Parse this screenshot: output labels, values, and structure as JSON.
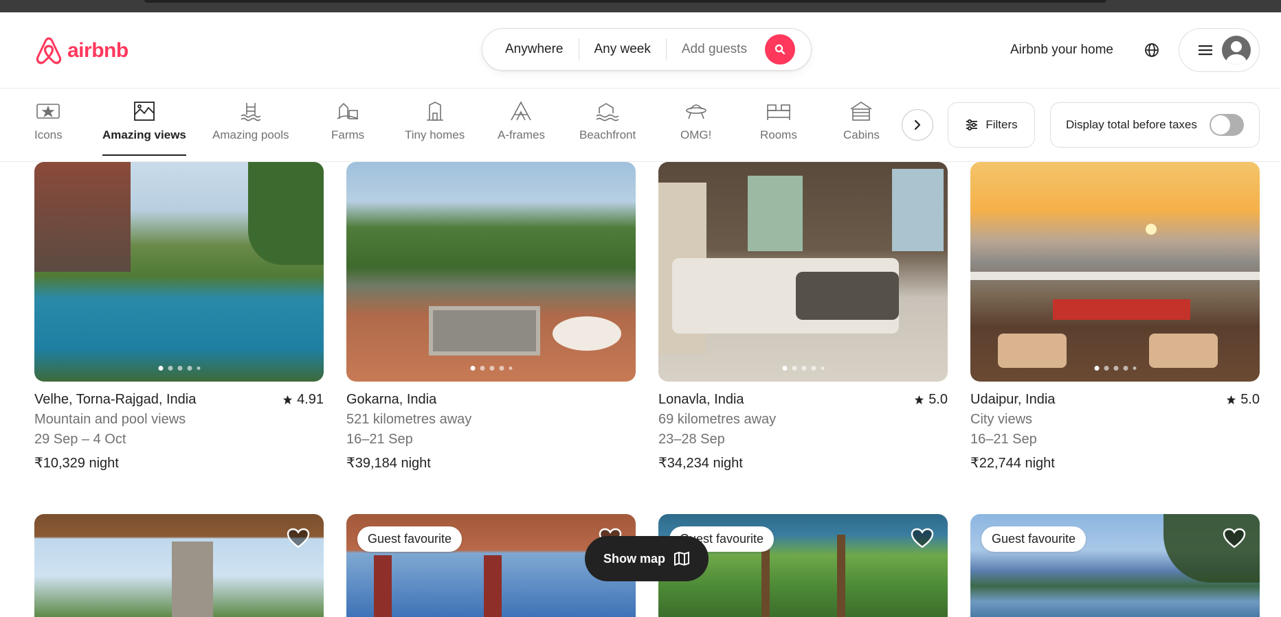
{
  "brand": {
    "name": "airbnb",
    "color": "#ff385c"
  },
  "search": {
    "where": "Anywhere",
    "when": "Any week",
    "who": "Add guests"
  },
  "header": {
    "host_link": "Airbnb your home"
  },
  "categories": [
    {
      "label": "Icons",
      "icon": "icons-icon"
    },
    {
      "label": "Amazing views",
      "icon": "amazing-views-icon",
      "active": true
    },
    {
      "label": "Amazing pools",
      "icon": "pool-icon"
    },
    {
      "label": "Farms",
      "icon": "farm-icon"
    },
    {
      "label": "Tiny homes",
      "icon": "tiny-home-icon"
    },
    {
      "label": "A-frames",
      "icon": "a-frame-icon"
    },
    {
      "label": "Beachfront",
      "icon": "beachfront-icon"
    },
    {
      "label": "OMG!",
      "icon": "ufo-icon"
    },
    {
      "label": "Rooms",
      "icon": "rooms-icon"
    },
    {
      "label": "Cabins",
      "icon": "cabin-icon"
    }
  ],
  "filters": {
    "label": "Filters"
  },
  "taxes": {
    "label": "Display total before taxes",
    "enabled": false
  },
  "listings": [
    {
      "location": "Velhe, Torna-Rajgad, India",
      "rating": "4.91",
      "subtitle": "Mountain and pool views",
      "dates": "29 Sep – 4 Oct",
      "price": "₹10,329",
      "unit": "night"
    },
    {
      "location": "Gokarna, India",
      "rating": "",
      "subtitle": "521 kilometres away",
      "dates": "16–21 Sep",
      "price": "₹39,184",
      "unit": "night"
    },
    {
      "location": "Lonavla, India",
      "rating": "5.0",
      "subtitle": "69 kilometres away",
      "dates": "23–28 Sep",
      "price": "₹34,234",
      "unit": "night"
    },
    {
      "location": "Udaipur, India",
      "rating": "5.0",
      "subtitle": "City views",
      "dates": "16–21 Sep",
      "price": "₹22,744",
      "unit": "night"
    }
  ],
  "second_row": [
    {
      "badge": ""
    },
    {
      "badge": "Guest favourite"
    },
    {
      "badge": "Guest favourite"
    },
    {
      "badge": "Guest favourite"
    }
  ],
  "show_map": {
    "label": "Show map"
  }
}
